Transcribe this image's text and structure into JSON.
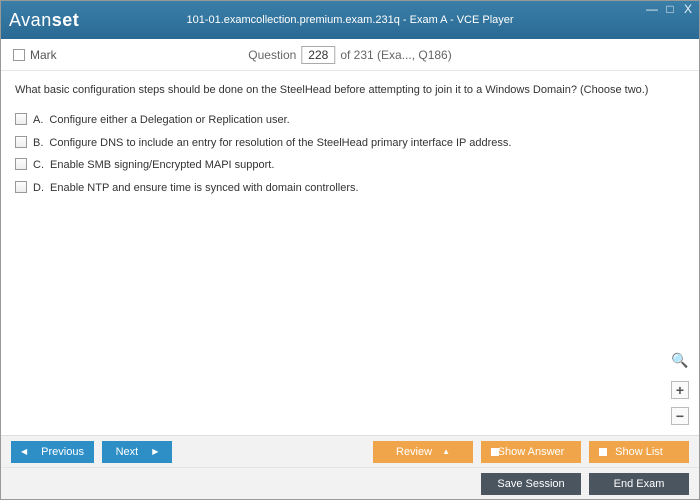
{
  "window": {
    "logo_a": "Avan",
    "logo_b": "set",
    "title": "101-01.examcollection.premium.exam.231q - Exam A - VCE Player",
    "controls": {
      "min": "—",
      "max": "□",
      "close": "X"
    }
  },
  "qbar": {
    "mark": "Mark",
    "label_pre": "Question",
    "number": "228",
    "label_post": "of 231 (Exa..., Q186)"
  },
  "stem": "What basic configuration steps should be done on the SteelHead before attempting to join it to a Windows Domain? (Choose two.)",
  "options": [
    {
      "letter": "A.",
      "text": "Configure either a Delegation or Replication user."
    },
    {
      "letter": "B.",
      "text": "Configure DNS to include an entry for resolution of the SteelHead primary interface IP address."
    },
    {
      "letter": "C.",
      "text": "Enable SMB signing/Encrypted MAPI support."
    },
    {
      "letter": "D.",
      "text": "Enable NTP and ensure time is synced with domain controllers."
    }
  ],
  "zoom": {
    "plus": "+",
    "minus": "−"
  },
  "footer": {
    "previous": "Previous",
    "next": "Next",
    "review": "Review",
    "show_answer": "Show Answer",
    "show_list": "Show List",
    "save_session": "Save Session",
    "end_exam": "End Exam"
  }
}
